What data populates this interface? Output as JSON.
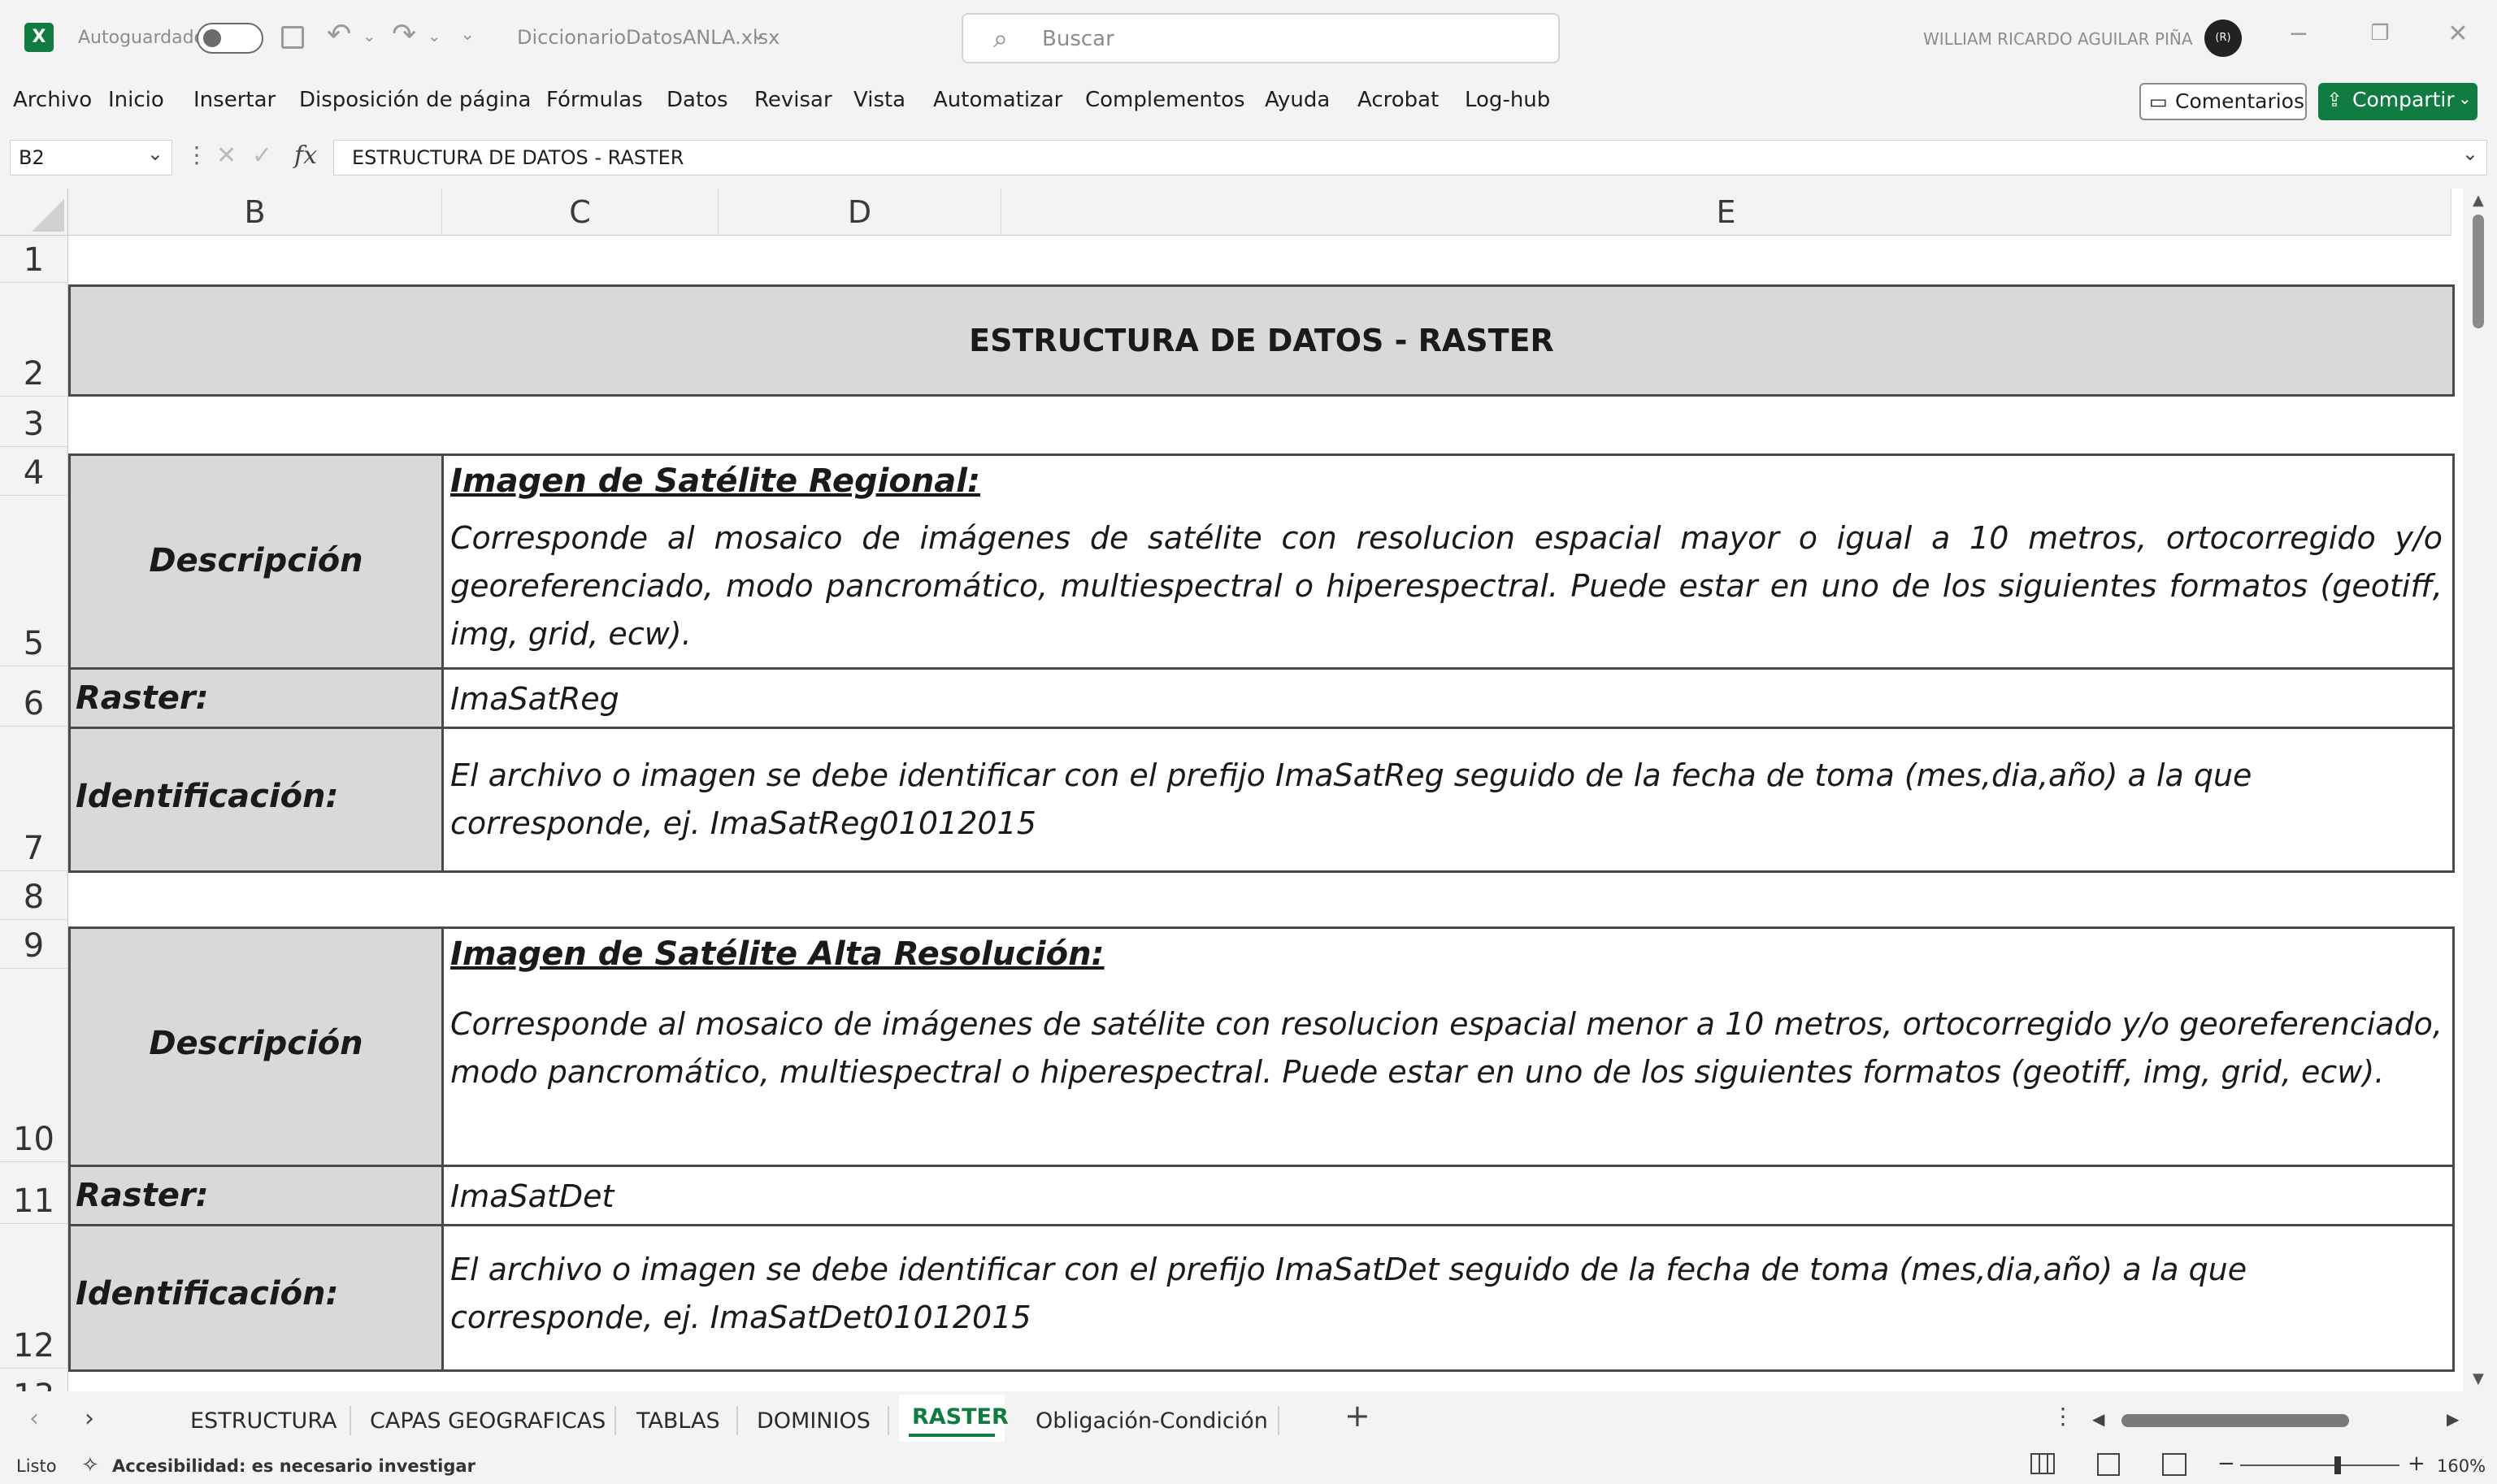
{
  "titlebar": {
    "autosave_label": "Autoguardado",
    "filename": "DiccionarioDatosANLA.xlsx",
    "search_placeholder": "Buscar",
    "user_name": "WILLIAM RICARDO AGUILAR PIÑA",
    "avatar_initials": "(R)"
  },
  "menu": {
    "items": [
      "Archivo",
      "Inicio",
      "Insertar",
      "Disposición de página",
      "Fórmulas",
      "Datos",
      "Revisar",
      "Vista",
      "Automatizar",
      "Complementos",
      "Ayuda",
      "Acrobat",
      "Log-hub"
    ],
    "comments_label": "Comentarios",
    "share_label": "Compartir"
  },
  "formula_bar": {
    "name_box": "B2",
    "fx": "fx",
    "content": "ESTRUCTURA DE DATOS - RASTER"
  },
  "columns": [
    "B",
    "C",
    "D",
    "E"
  ],
  "rows": [
    "1",
    "2",
    "3",
    "4",
    "5",
    "6",
    "7",
    "8",
    "9",
    "10",
    "11",
    "12",
    "13"
  ],
  "sheet": {
    "title": "ESTRUCTURA DE DATOS - RASTER",
    "block1": {
      "desc_label": "Descripción",
      "heading": "Imagen de Satélite Regional:",
      "desc_text": "Corresponde al mosaico de imágenes de satélite con resolucion espacial mayor o igual a 10 metros, ortocorregido y/o georeferenciado, modo pancromático, multiespectral o hiperespectral. Puede estar en uno de los siguientes formatos (geotiff, img, grid, ecw).",
      "raster_label": "Raster:",
      "raster_value": "ImaSatReg",
      "id_label": "Identificación:",
      "id_text": "El archivo o imagen se debe identificar con el prefijo  ImaSatReg seguido de la fecha de toma (mes,dia,año) a la que corresponde, ej. ImaSatReg01012015"
    },
    "block2": {
      "desc_label": "Descripción",
      "heading": "Imagen de Satélite Alta Resolución:",
      "desc_text": "Corresponde al mosaico de imágenes de satélite con resolucion espacial menor a 10 metros, ortocorregido y/o georeferenciado, modo pancromático, multiespectral o hiperespectral. Puede estar en uno de los siguientes formatos (geotiff, img, grid, ecw).",
      "raster_label": "Raster:",
      "raster_value": "ImaSatDet",
      "id_label": "Identificación:",
      "id_text": "El archivo o imagen se debe identificar con el prefijo ImaSatDet seguido de la fecha de toma (mes,dia,año) a la que corresponde, ej. ImaSatDet01012015"
    }
  },
  "sheet_tabs": [
    "ESTRUCTURA",
    "CAPAS GEOGRAFICAS",
    "TABLAS",
    "DOMINIOS",
    "RASTER",
    "Obligación-Condición"
  ],
  "active_tab": "RASTER",
  "status": {
    "ready": "Listo",
    "accessibility": "Accesibilidad: es necesario investigar",
    "zoom": "160%"
  },
  "colors": {
    "excel_green": "#107c41",
    "header_gray": "#d9d9d9",
    "border": "#4a4a4a"
  }
}
